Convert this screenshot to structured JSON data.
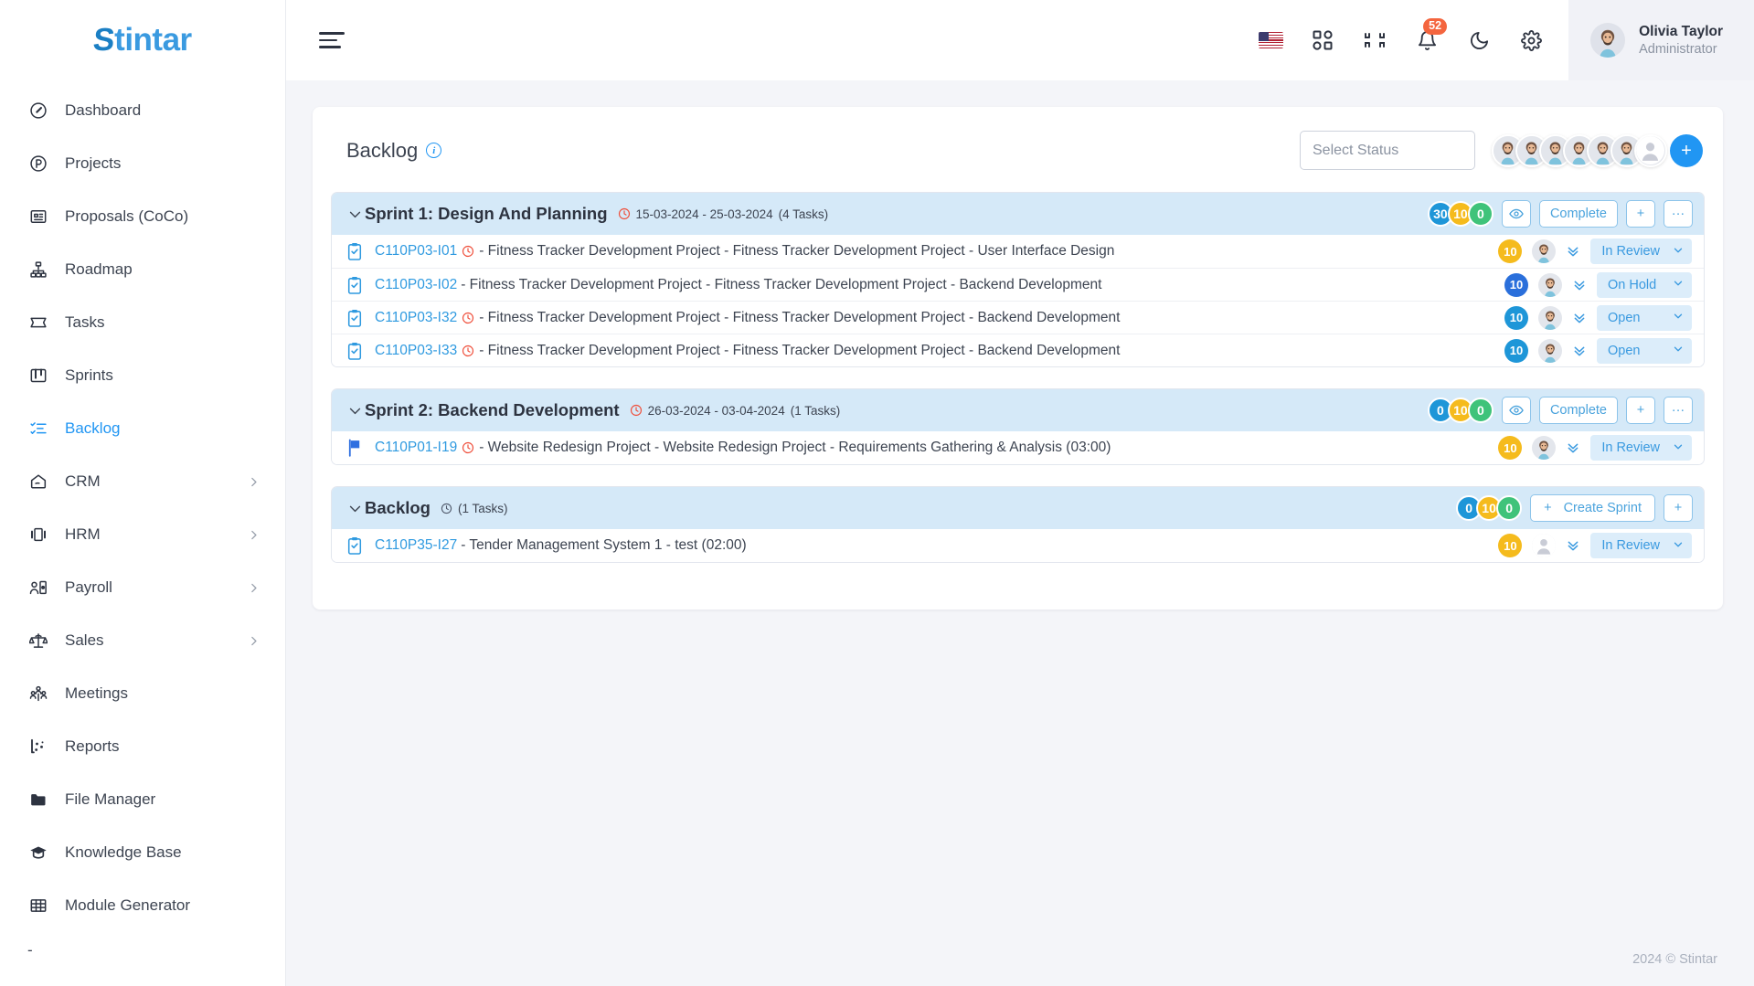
{
  "brand": {
    "name": "Stintar",
    "first_letter": "S",
    "rest": "tintar"
  },
  "sidebar": {
    "items": [
      {
        "label": "Dashboard",
        "icon": "dashboard-icon",
        "has_chevron": false,
        "active": false
      },
      {
        "label": "Projects",
        "icon": "projects-icon",
        "has_chevron": false,
        "active": false
      },
      {
        "label": "Proposals (CoCo)",
        "icon": "proposals-icon",
        "has_chevron": false,
        "active": false
      },
      {
        "label": "Roadmap",
        "icon": "roadmap-icon",
        "has_chevron": false,
        "active": false
      },
      {
        "label": "Tasks",
        "icon": "tasks-icon",
        "has_chevron": false,
        "active": false
      },
      {
        "label": "Sprints",
        "icon": "sprints-icon",
        "has_chevron": false,
        "active": false
      },
      {
        "label": "Backlog",
        "icon": "backlog-icon",
        "has_chevron": false,
        "active": true
      },
      {
        "label": "CRM",
        "icon": "crm-icon",
        "has_chevron": true,
        "active": false
      },
      {
        "label": "HRM",
        "icon": "hrm-icon",
        "has_chevron": true,
        "active": false
      },
      {
        "label": "Payroll",
        "icon": "payroll-icon",
        "has_chevron": true,
        "active": false
      },
      {
        "label": "Sales",
        "icon": "sales-icon",
        "has_chevron": true,
        "active": false
      },
      {
        "label": "Meetings",
        "icon": "meetings-icon",
        "has_chevron": false,
        "active": false
      },
      {
        "label": "Reports",
        "icon": "reports-icon",
        "has_chevron": false,
        "active": false
      },
      {
        "label": "File Manager",
        "icon": "folder-icon",
        "has_chevron": false,
        "active": false
      },
      {
        "label": "Knowledge Base",
        "icon": "graduation-cap-icon",
        "has_chevron": false,
        "active": false
      },
      {
        "label": "Module Generator",
        "icon": "grid-icon",
        "has_chevron": false,
        "active": false
      }
    ],
    "trailing_dash": "-"
  },
  "topbar": {
    "menu_toggle": "hamburger-icon",
    "icons": [
      {
        "name": "language-flag-us",
        "label": "US"
      },
      {
        "name": "apps-grid-icon",
        "label": "Apps"
      },
      {
        "name": "fullscreen-exit-icon",
        "label": "Collapse"
      },
      {
        "name": "notifications-bell-icon",
        "label": "Notifications",
        "badge": "52"
      },
      {
        "name": "dark-mode-icon",
        "label": "Dark mode"
      },
      {
        "name": "settings-gear-icon",
        "label": "Settings"
      }
    ],
    "notification_count": "52",
    "profile": {
      "name": "Olivia Taylor",
      "role": "Administrator",
      "avatar": "user-avatar"
    }
  },
  "page": {
    "title": "Backlog",
    "info_icon": "info-icon",
    "status_filter": {
      "placeholder": "Select Status",
      "value": ""
    },
    "member_avatars_count": 6,
    "placeholder_avatar": "empty-user-avatar",
    "add_member_label": "+"
  },
  "groups": [
    {
      "name": "Sprint 1: Design And Planning",
      "dates": "15-03-2024 - 25-03-2024",
      "task_count": "(4 Tasks)",
      "badges": [
        {
          "value": "30",
          "color": "blue"
        },
        {
          "value": "10",
          "color": "yellow"
        },
        {
          "value": "0",
          "color": "green"
        }
      ],
      "actions": {
        "eye": "eye-icon",
        "complete": "Complete",
        "add": "+",
        "more": "···"
      },
      "type": "sprint",
      "tasks": [
        {
          "icon": "task-clipboard-icon",
          "key": "C110P03-I01",
          "has_clock": true,
          "text": "- Fitness Tracker Development Project - Fitness Tracker Development Project - User Interface Design",
          "points": "10",
          "points_color": "amber",
          "assignee": "user-avatar",
          "status": "In Review"
        },
        {
          "icon": "task-clipboard-icon",
          "key": "C110P03-I02",
          "has_clock": false,
          "text": "- Fitness Tracker Development Project - Fitness Tracker Development Project - Backend Development",
          "points": "10",
          "points_color": "navy",
          "assignee": "user-avatar",
          "status": "On Hold"
        },
        {
          "icon": "task-clipboard-icon",
          "key": "C110P03-I32",
          "has_clock": true,
          "text": "- Fitness Tracker Development Project - Fitness Tracker Development Project - Backend Development",
          "points": "10",
          "points_color": "blue",
          "assignee": "user-avatar",
          "status": "Open"
        },
        {
          "icon": "task-clipboard-icon",
          "key": "C110P03-I33",
          "has_clock": true,
          "text": "- Fitness Tracker Development Project - Fitness Tracker Development Project - Backend Development",
          "points": "10",
          "points_color": "blue",
          "assignee": "user-avatar",
          "status": "Open"
        }
      ]
    },
    {
      "name": "Sprint 2: Backend Development",
      "dates": "26-03-2024 - 03-04-2024",
      "task_count": "(1 Tasks)",
      "badges": [
        {
          "value": "0",
          "color": "blue"
        },
        {
          "value": "10",
          "color": "yellow"
        },
        {
          "value": "0",
          "color": "green"
        }
      ],
      "actions": {
        "eye": "eye-icon",
        "complete": "Complete",
        "add": "+",
        "more": "···"
      },
      "type": "sprint",
      "tasks": [
        {
          "icon": "flag-icon",
          "key": "C110P01-I19",
          "has_clock": true,
          "text": "- Website Redesign Project - Website Redesign Project - Requirements Gathering & Analysis (03:00)",
          "points": "10",
          "points_color": "amber",
          "assignee": "user-avatar",
          "status": "In Review"
        }
      ]
    },
    {
      "name": "Backlog",
      "dates": "",
      "task_count": "(1 Tasks)",
      "badges": [
        {
          "value": "0",
          "color": "blue"
        },
        {
          "value": "10",
          "color": "yellow"
        },
        {
          "value": "0",
          "color": "green"
        }
      ],
      "actions": {
        "create_sprint": "Create Sprint",
        "create_sprint_plus": "+",
        "add": "+"
      },
      "type": "backlog",
      "tasks": [
        {
          "icon": "task-clipboard-icon",
          "key": "C110P35-I27",
          "has_clock": false,
          "text": "- Tender Management System 1 - test (02:00)",
          "points": "10",
          "points_color": "amber",
          "assignee": "empty-user-avatar",
          "status": "In Review"
        }
      ]
    }
  ],
  "footer": {
    "copyright": "2024 © Stintar"
  },
  "colors": {
    "accent": "#2196f3",
    "brand": "#3a9ae0",
    "sprint_header_bg": "#d5e9f8",
    "badge_blue": "#1e96d8",
    "badge_yellow": "#f5bb1d",
    "badge_green": "#3fc37a",
    "notification_badge": "#f4653e",
    "clock_red": "#ef4e3a"
  }
}
